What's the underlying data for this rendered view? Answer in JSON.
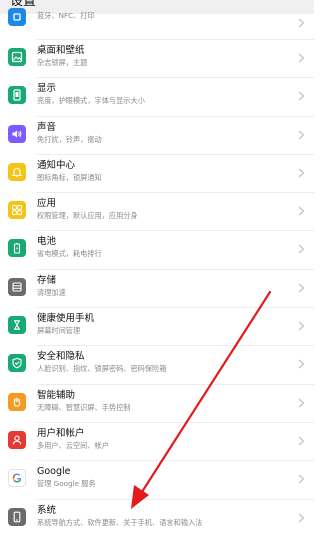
{
  "header": {
    "title": "设置"
  },
  "colors": {
    "network": "#1e88e5",
    "display": "#19a974",
    "wallpaper": "#19a974",
    "sound": "#7b5cff",
    "notify": "#f6c418",
    "apps": "#f6c418",
    "battery": "#19a974",
    "storage": "#6b6b6b",
    "health": "#19a974",
    "security": "#19a974",
    "assist": "#f59b23",
    "users": "#e53935",
    "system": "#6b6b6b",
    "arrow": "#e21b1b"
  },
  "items": [
    {
      "icon": "device-connection-icon",
      "label": "",
      "sub": "蓝牙、NFC、打印"
    },
    {
      "icon": "wallpaper-icon",
      "label": "桌面和壁纸",
      "sub": "杂志锁屏，主题"
    },
    {
      "icon": "display-icon",
      "label": "显示",
      "sub": "亮度，护眼模式，字体与显示大小"
    },
    {
      "icon": "sound-icon",
      "label": "声音",
      "sub": "免打扰，铃声，振动"
    },
    {
      "icon": "bell-icon",
      "label": "通知中心",
      "sub": "图标角标，锁屏通知"
    },
    {
      "icon": "apps-icon",
      "label": "应用",
      "sub": "权限管理，默认应用，应用分身"
    },
    {
      "icon": "battery-icon",
      "label": "电池",
      "sub": "省电模式，耗电排行"
    },
    {
      "icon": "storage-icon",
      "label": "存储",
      "sub": "清理加速"
    },
    {
      "icon": "hourglass-icon",
      "label": "健康使用手机",
      "sub": "屏幕时间管理"
    },
    {
      "icon": "shield-icon",
      "label": "安全和隐私",
      "sub": "人脸识别、指纹、锁屏密码、密码保险箱"
    },
    {
      "icon": "hand-icon",
      "label": "智能辅助",
      "sub": "无障碍、智慧识屏、手势控制"
    },
    {
      "icon": "user-icon",
      "label": "用户和帐户",
      "sub": "多用户、云空间、帐户"
    },
    {
      "icon": "google-icon",
      "label": "Google",
      "sub": "管理 Google 服务"
    },
    {
      "icon": "phone-system-icon",
      "label": "系统",
      "sub": "系统导航方式、软件更新、关于手机、语言和输入法"
    }
  ]
}
